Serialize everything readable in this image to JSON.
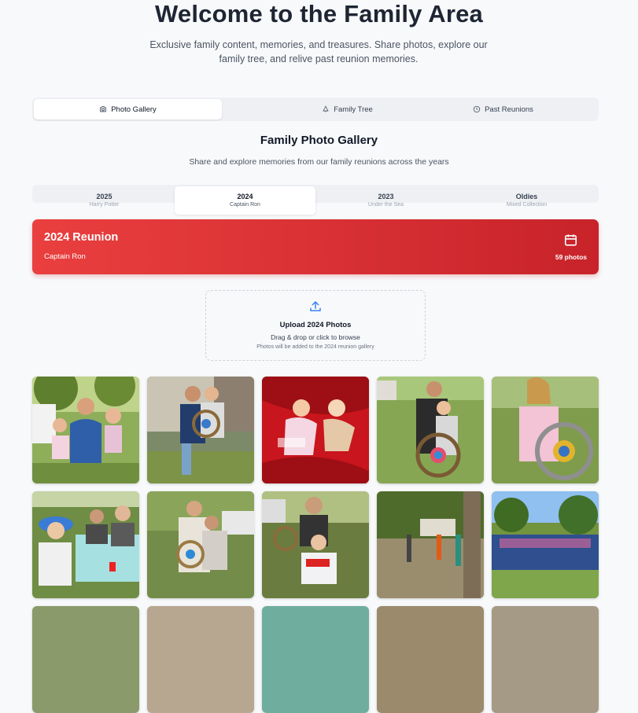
{
  "header": {
    "title": "Welcome to the Family Area",
    "subtitle": "Exclusive family content, memories, and treasures. Share photos, explore our family tree, and relive past reunion memories."
  },
  "tabs": [
    {
      "label": "Photo Gallery",
      "icon": "camera-icon",
      "active": true
    },
    {
      "label": "Family Tree",
      "icon": "tree-icon",
      "active": false
    },
    {
      "label": "Past Reunions",
      "icon": "clock-icon",
      "active": false
    }
  ],
  "gallery": {
    "title": "Family Photo Gallery",
    "subtitle": "Share and explore memories from our family reunions across the years"
  },
  "years": [
    {
      "year": "2025",
      "theme": "Harry Potter",
      "active": false
    },
    {
      "year": "2024",
      "theme": "Captain Ron",
      "active": true
    },
    {
      "year": "2023",
      "theme": "Under the Sea",
      "active": false
    },
    {
      "year": "Oldies",
      "theme": "Mixed Collection",
      "active": false
    }
  ],
  "banner": {
    "title": "2024 Reunion",
    "theme": "Captain Ron",
    "count": "59 photos",
    "icon": "calendar-icon",
    "colors": {
      "from": "#ea3f3f",
      "to": "#c8232a"
    }
  },
  "upload": {
    "icon": "upload-icon",
    "title": "Upload 2024 Photos",
    "hint": "Drag & drop or click to browse",
    "note": "Photos will be added to the 2024 reunion gallery"
  },
  "photos_count_visible": 10
}
